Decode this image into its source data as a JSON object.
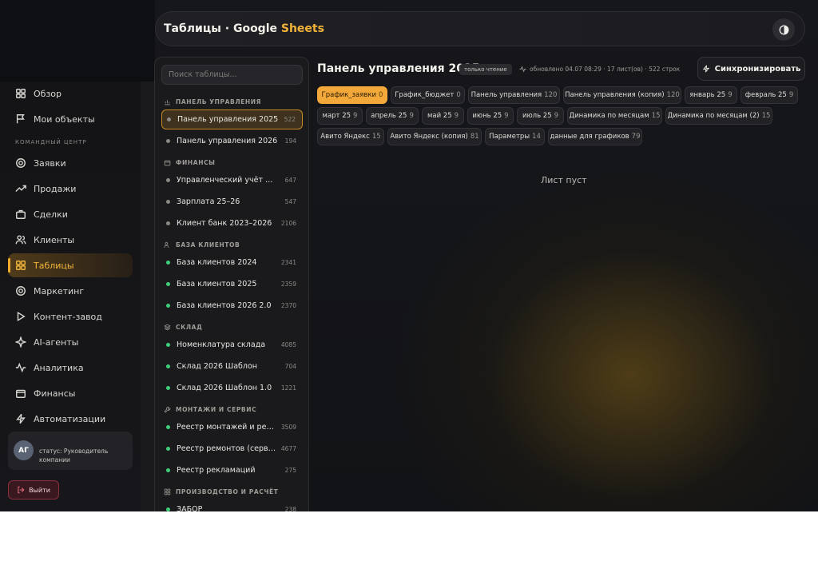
{
  "header": {
    "title_prefix": "Таблицы · ",
    "title_google": "Google",
    "title_sheets": "Sheets"
  },
  "nav": {
    "items_top": [
      {
        "label": "Обзор",
        "icon": "grid-icon"
      },
      {
        "label": "Мои объекты",
        "icon": "flag-icon"
      }
    ],
    "section_label": "КОМАНДНЫЙ ЦЕНТР",
    "items": [
      {
        "label": "Заявки",
        "icon": "target-icon"
      },
      {
        "label": "Продажи",
        "icon": "trend-icon"
      },
      {
        "label": "Сделки",
        "icon": "briefcase-icon"
      },
      {
        "label": "Клиенты",
        "icon": "users-icon"
      },
      {
        "label": "Таблицы",
        "icon": "table-icon",
        "active": true
      },
      {
        "label": "Маркетинг",
        "icon": "target-icon"
      },
      {
        "label": "Контент-завод",
        "icon": "play-icon"
      },
      {
        "label": "AI-агенты",
        "icon": "sparkle-icon"
      },
      {
        "label": "Аналитика",
        "icon": "pulse-icon"
      },
      {
        "label": "Финансы",
        "icon": "wallet-icon"
      },
      {
        "label": "Автоматизации",
        "icon": "bolt-icon"
      }
    ]
  },
  "user": {
    "initials": "АГ",
    "status": "статус: Руководитель компании"
  },
  "logout_label": "Выйти",
  "tables_panel": {
    "search_placeholder": "Поиск таблицы...",
    "groups": [
      {
        "name": "ПАНЕЛЬ УПРАВЛЕНИЯ",
        "items": [
          {
            "label": "Панель управления 2025",
            "count": "522",
            "active": true
          },
          {
            "label": "Панель управления 2026",
            "count": "194"
          }
        ]
      },
      {
        "name": "ФИНАНСЫ",
        "items": [
          {
            "label": "Управленческий учёт — расходы",
            "count": "647"
          },
          {
            "label": "Зарплата 25–26",
            "count": "547"
          },
          {
            "label": "Клиент банк 2023–2026",
            "count": "2106"
          }
        ]
      },
      {
        "name": "БАЗА КЛИЕНТОВ",
        "items": [
          {
            "label": "База клиентов 2024",
            "count": "2341"
          },
          {
            "label": "База клиентов 2025",
            "count": "2359"
          },
          {
            "label": "База клиентов 2026 2.0",
            "count": "2370"
          }
        ]
      },
      {
        "name": "СКЛАД",
        "items": [
          {
            "label": "Номенклатура склада",
            "count": "4085"
          },
          {
            "label": "Склад 2026 Шаблон",
            "count": "704"
          },
          {
            "label": "Склад 2026 Шаблон 1.0",
            "count": "1221"
          }
        ]
      },
      {
        "name": "МОНТАЖИ И СЕРВИС",
        "items": [
          {
            "label": "Реестр монтажей и ремонтов",
            "count": "3509"
          },
          {
            "label": "Реестр ремонтов (сервис)",
            "count": "4677"
          },
          {
            "label": "Реестр рекламаций",
            "count": "275"
          }
        ]
      },
      {
        "name": "ПРОИЗВОДСТВО И РАСЧЁТ",
        "items": [
          {
            "label": "ЗАБОР",
            "count": "238"
          }
        ]
      }
    ]
  },
  "main": {
    "title": "Панель управления 2025",
    "badge": "только чтение",
    "meta": "обновлено 04.07 08:29 · 17 лист(ов) · 522 строк",
    "sync_label": "Синхронизировать",
    "tabs": [
      {
        "label": "График_заявки",
        "count": "0",
        "active": true
      },
      {
        "label": "График_бюджет",
        "count": "0"
      },
      {
        "label": "Панель управления",
        "count": "120"
      },
      {
        "label": "Панель управления (копия)",
        "count": "120"
      },
      {
        "label": "январь 25",
        "count": "9"
      },
      {
        "label": "февраль 25",
        "count": "9"
      },
      {
        "label": "март 25",
        "count": "9"
      },
      {
        "label": "апрель 25",
        "count": "9"
      },
      {
        "label": "май 25",
        "count": "9"
      },
      {
        "label": "июнь 25",
        "count": "9"
      },
      {
        "label": "июль 25",
        "count": "9"
      },
      {
        "label": "Динамика по месяцам",
        "count": "15"
      },
      {
        "label": "Динамика по месяцам (2)",
        "count": "15"
      },
      {
        "label": "Авито Яндекс",
        "count": "15"
      },
      {
        "label": "Авито Яндекс (копия)",
        "count": "81"
      },
      {
        "label": "Параметры",
        "count": "14"
      },
      {
        "label": "данные для графиков",
        "count": "79"
      }
    ],
    "empty_message": "Лист пуст"
  }
}
